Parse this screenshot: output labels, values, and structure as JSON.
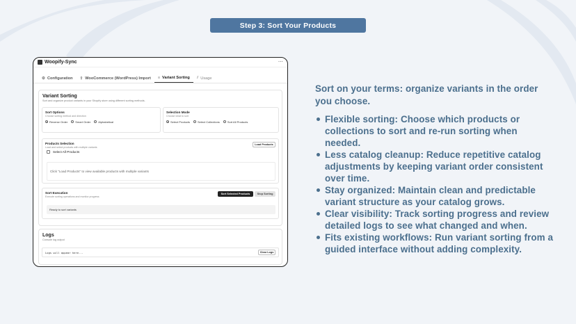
{
  "banner": {
    "label": "Step 3: Sort Your Products"
  },
  "window": {
    "title": "Woopify-Sync",
    "menu": "···",
    "tabs": [
      {
        "label": "Configuration",
        "icon": "gear-icon"
      },
      {
        "label": "WooCommerce (WordPress) Import",
        "icon": "upload-icon"
      },
      {
        "label": "Variant Sorting",
        "icon": "sort-icon",
        "active": true
      },
      {
        "label": "Usage",
        "icon": "chart-icon"
      }
    ],
    "main": {
      "title": "Variant Sorting",
      "subtitle": "Sort and organize product variants in your Shopify store using different sorting methods.",
      "sort_options": {
        "title": "Sort Options",
        "subtitle": "Choose sorting method and direction",
        "options": [
          "Reverse Order",
          "Smart Order",
          "Alphabetical"
        ],
        "selected": "Reverse Order"
      },
      "selection_mode": {
        "title": "Selection Mode",
        "subtitle": "Choose what to sort",
        "options": [
          "Select Products",
          "Select Collections",
          "Sort All Products"
        ],
        "selected": "Select Products"
      },
      "products_selection": {
        "title": "Products Selection",
        "subtitle": "Load and select products with multiple variants",
        "load_button": "Load Products",
        "select_all": "Select All Products",
        "hint": "Click \"Load Products\" to view available products with multiple variants"
      },
      "sort_execution": {
        "title": "Sort Execution",
        "subtitle": "Execute sorting operations and monitor progress",
        "sort_button": "Sort Selected Products",
        "stop_button": "Stop Sorting",
        "status": "Ready to sort variants"
      }
    },
    "logs": {
      "title": "Logs",
      "subtitle": "Console log output",
      "placeholder": "Logs will appear here...",
      "clear_button": "Clear Logs"
    }
  },
  "content": {
    "lead": "Sort on your terms: organize variants in the order you choose.",
    "bullets": [
      "Flexible sorting: Choose which products or collections to sort and re-run sorting when needed.",
      "Less catalog cleanup: Reduce repetitive catalog adjustments by keeping variant order consistent over time.",
      "Stay organized: Maintain clean and predictable variant structure as your catalog grows.",
      "Clear visibility: Track sorting progress and review detailed logs to see what changed and when.",
      "Fits existing workflows: Run variant sorting from a guided interface without adding complexity."
    ]
  },
  "colors": {
    "accent": "#4f76a0",
    "text": "#4b6f8d",
    "background": "#f1f4f8"
  }
}
